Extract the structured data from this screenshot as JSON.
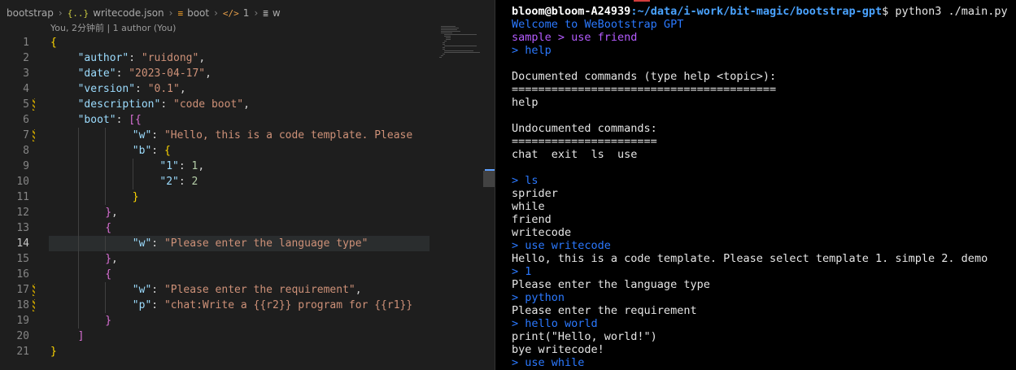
{
  "colors": {
    "editor_bg": "#1e1e1e",
    "terminal_bg": "#000000",
    "json_key": "#9cdcfe",
    "json_string": "#ce9178",
    "json_number": "#b5cea8"
  },
  "breadcrumb": {
    "items": [
      {
        "label": "bootstrap",
        "icon": ""
      },
      {
        "label": "writecode.json",
        "icon": "{..}"
      },
      {
        "label": "boot",
        "icon": "≡"
      },
      {
        "label": "1",
        "icon": "</>"
      },
      {
        "label": "w",
        "icon": "≣"
      }
    ]
  },
  "blame": {
    "text": "You, 2分钟前 | 1 author (You)"
  },
  "editor": {
    "current_line": 14,
    "lines": [
      {
        "num": "1",
        "indent": 0,
        "parts": [
          [
            "b1",
            "{"
          ]
        ]
      },
      {
        "num": "2",
        "indent": 1,
        "parts": [
          [
            "k",
            "\"author\""
          ],
          [
            "p",
            ": "
          ],
          [
            "s",
            "\"ruidong\""
          ],
          [
            "p",
            ","
          ]
        ]
      },
      {
        "num": "3",
        "indent": 1,
        "parts": [
          [
            "k",
            "\"date\""
          ],
          [
            "p",
            ": "
          ],
          [
            "s",
            "\"2023-04-17\""
          ],
          [
            "p",
            ","
          ]
        ]
      },
      {
        "num": "4",
        "indent": 1,
        "parts": [
          [
            "k",
            "\"version\""
          ],
          [
            "p",
            ": "
          ],
          [
            "s",
            "\"0.1\""
          ],
          [
            "p",
            ","
          ]
        ]
      },
      {
        "num": "5",
        "indent": 1,
        "parts": [
          [
            "k",
            "\"description\""
          ],
          [
            "p",
            ": "
          ],
          [
            "s",
            "\"code boot\""
          ],
          [
            "p",
            ","
          ]
        ]
      },
      {
        "num": "6",
        "indent": 1,
        "parts": [
          [
            "k",
            "\"boot\""
          ],
          [
            "p",
            ": "
          ],
          [
            "b2",
            "["
          ],
          [
            "b2",
            "{"
          ]
        ]
      },
      {
        "num": "7",
        "indent": 3,
        "parts": [
          [
            "k",
            "\"w\""
          ],
          [
            "p",
            ": "
          ],
          [
            "s",
            "\"Hello, this is a code template. Please"
          ]
        ]
      },
      {
        "num": "8",
        "indent": 3,
        "parts": [
          [
            "k",
            "\"b\""
          ],
          [
            "p",
            ": "
          ],
          [
            "b1",
            "{"
          ]
        ]
      },
      {
        "num": "9",
        "indent": 4,
        "parts": [
          [
            "k",
            "\"1\""
          ],
          [
            "p",
            ": "
          ],
          [
            "n",
            "1"
          ],
          [
            "p",
            ","
          ]
        ]
      },
      {
        "num": "10",
        "indent": 4,
        "parts": [
          [
            "k",
            "\"2\""
          ],
          [
            "p",
            ": "
          ],
          [
            "n",
            "2"
          ]
        ]
      },
      {
        "num": "11",
        "indent": 3,
        "parts": [
          [
            "b1",
            "}"
          ]
        ]
      },
      {
        "num": "12",
        "indent": 2,
        "parts": [
          [
            "b2",
            "}"
          ],
          [
            "p",
            ","
          ]
        ]
      },
      {
        "num": "13",
        "indent": 2,
        "parts": [
          [
            "b2",
            "{"
          ]
        ]
      },
      {
        "num": "14",
        "indent": 3,
        "parts": [
          [
            "k",
            "\"w\""
          ],
          [
            "p",
            ": "
          ],
          [
            "s",
            "\"Please enter the language type\""
          ]
        ]
      },
      {
        "num": "15",
        "indent": 2,
        "parts": [
          [
            "b2",
            "}"
          ],
          [
            "p",
            ","
          ]
        ]
      },
      {
        "num": "16",
        "indent": 2,
        "parts": [
          [
            "b2",
            "{"
          ]
        ]
      },
      {
        "num": "17",
        "indent": 3,
        "parts": [
          [
            "k",
            "\"w\""
          ],
          [
            "p",
            ": "
          ],
          [
            "s",
            "\"Please enter the requirement\""
          ],
          [
            "p",
            ","
          ]
        ]
      },
      {
        "num": "18",
        "indent": 3,
        "parts": [
          [
            "k",
            "\"p\""
          ],
          [
            "p",
            ": "
          ],
          [
            "s",
            "\"chat:Write a {{r2}} program for {{r1}}"
          ]
        ]
      },
      {
        "num": "19",
        "indent": 2,
        "parts": [
          [
            "b2",
            "}"
          ]
        ]
      },
      {
        "num": "20",
        "indent": 1,
        "parts": [
          [
            "b2",
            "]"
          ]
        ]
      },
      {
        "num": "21",
        "indent": 0,
        "parts": [
          [
            "b1",
            "}"
          ]
        ]
      }
    ]
  },
  "terminal": {
    "prompt_user": "bloom@bloom-A24939",
    "prompt_path": ":~/data/i-work/bit-magic/bootstrap-gpt",
    "prompt_cmd": "$ python3 ./main.py",
    "lines": [
      {
        "text": "Welcome to WeBootstrap GPT",
        "style": "blue"
      },
      {
        "text": "sample > use friend",
        "style": "purple"
      },
      {
        "text": "> help",
        "style": "blue"
      },
      {
        "text": "",
        "style": ""
      },
      {
        "text": "Documented commands (type help <topic>):",
        "style": ""
      },
      {
        "text": "========================================",
        "style": ""
      },
      {
        "text": "help",
        "style": ""
      },
      {
        "text": "",
        "style": ""
      },
      {
        "text": "Undocumented commands:",
        "style": ""
      },
      {
        "text": "======================",
        "style": ""
      },
      {
        "text": "chat  exit  ls  use",
        "style": ""
      },
      {
        "text": "",
        "style": ""
      },
      {
        "text": "> ls",
        "style": "blue"
      },
      {
        "text": "sprider",
        "style": ""
      },
      {
        "text": "while",
        "style": ""
      },
      {
        "text": "friend",
        "style": ""
      },
      {
        "text": "writecode",
        "style": ""
      },
      {
        "text": "> use writecode",
        "style": "blue"
      },
      {
        "text": "Hello, this is a code template. Please select template 1. simple 2. demo",
        "style": ""
      },
      {
        "text": "> 1",
        "style": "blue"
      },
      {
        "text": "Please enter the language type",
        "style": ""
      },
      {
        "text": "> python",
        "style": "blue"
      },
      {
        "text": "Please enter the requirement",
        "style": ""
      },
      {
        "text": "> hello world",
        "style": "blue"
      },
      {
        "text": "print(\"Hello, world!\")",
        "style": ""
      },
      {
        "text": "bye writecode!",
        "style": ""
      },
      {
        "text": "> use while",
        "style": "blue"
      }
    ]
  }
}
